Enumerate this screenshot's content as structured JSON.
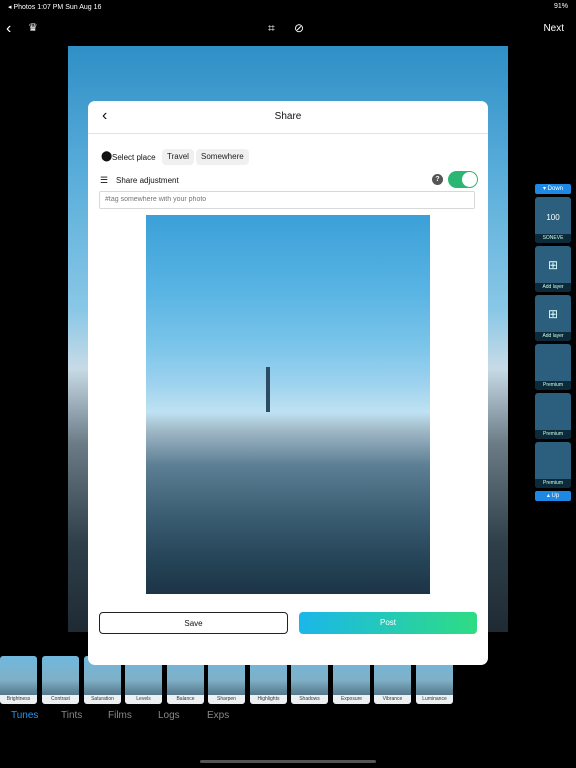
{
  "status": {
    "left": "◂ Photos   1:07 PM   Sun Aug 16",
    "right": "91%"
  },
  "topbar": {
    "next_label": "Next"
  },
  "dialog": {
    "title": "Share",
    "select_place_label": "Select place",
    "place_chips": [
      "Travel",
      "Somewhere"
    ],
    "share_adjustment_label": "Share adjustment",
    "help_glyph": "?",
    "tag_placeholder": "#tag somewhere with your photo",
    "save_label": "Save",
    "post_label": "Post",
    "toggle_on": true
  },
  "side_panel": {
    "down_label": "▾ Down",
    "up_label": "▴ Up",
    "tiles": [
      {
        "label": "SONEVE",
        "value": "100"
      },
      {
        "label": "Add layer",
        "value": ""
      },
      {
        "label": "Add layer",
        "value": ""
      },
      {
        "label": "Premium",
        "value": ""
      },
      {
        "label": "Premium",
        "value": ""
      },
      {
        "label": "Premium",
        "value": ""
      }
    ]
  },
  "filters": [
    "Brightness",
    "Contrast",
    "Saturation",
    "Levels",
    "Balance",
    "Sharpen",
    "Highlights",
    "Shadows",
    "Exposure",
    "Vibrance",
    "Luminance"
  ],
  "tabs": [
    "Tunes",
    "Tints",
    "Films",
    "Logs",
    "Exps"
  ],
  "active_tab": "Tunes",
  "colors": {
    "accent": "#2196f3",
    "toggle": "#2bb673",
    "post_start": "#1ab7ea",
    "post_end": "#2fdc83"
  }
}
